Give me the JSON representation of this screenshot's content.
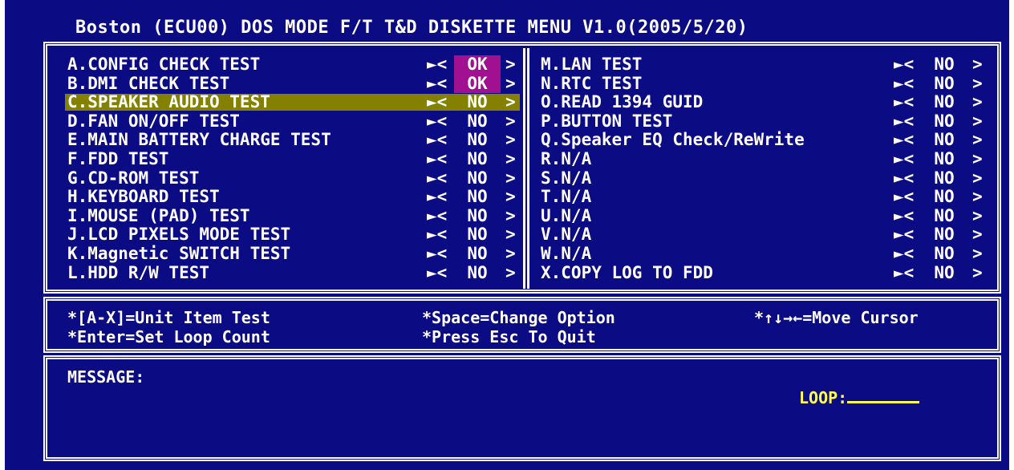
{
  "title": "Boston (ECU00) DOS MODE F/T T&D DISKETTE MENU V1.0(2005/5/20)",
  "arrow_glyph": "►<",
  "close_glyph": ">",
  "left_items": [
    {
      "label": "A.CONFIG CHECK TEST",
      "status": "OK"
    },
    {
      "label": "B.DMI CHECK TEST",
      "status": "OK"
    },
    {
      "label": "C.SPEAKER AUDIO TEST",
      "status": "NO",
      "selected": true
    },
    {
      "label": "D.FAN ON/OFF TEST",
      "status": "NO"
    },
    {
      "label": "E.MAIN BATTERY CHARGE TEST",
      "status": "NO"
    },
    {
      "label": "F.FDD TEST",
      "status": "NO"
    },
    {
      "label": "G.CD-ROM TEST",
      "status": "NO"
    },
    {
      "label": "H.KEYBOARD TEST",
      "status": "NO"
    },
    {
      "label": "I.MOUSE (PAD) TEST",
      "status": "NO"
    },
    {
      "label": "J.LCD PIXELS MODE TEST",
      "status": "NO"
    },
    {
      "label": "K.Magnetic SWITCH TEST",
      "status": "NO"
    },
    {
      "label": "L.HDD R/W TEST",
      "status": "NO"
    }
  ],
  "right_items": [
    {
      "label": "M.LAN TEST",
      "status": "NO"
    },
    {
      "label": "N.RTC TEST",
      "status": "NO"
    },
    {
      "label": "O.READ 1394 GUID",
      "status": "NO"
    },
    {
      "label": "P.BUTTON TEST",
      "status": "NO"
    },
    {
      "label": "Q.Speaker EQ Check/ReWrite",
      "status": "NO"
    },
    {
      "label": "R.N/A",
      "status": "NO"
    },
    {
      "label": "S.N/A",
      "status": "NO"
    },
    {
      "label": "T.N/A",
      "status": "NO"
    },
    {
      "label": "U.N/A",
      "status": "NO"
    },
    {
      "label": "V.N/A",
      "status": "NO"
    },
    {
      "label": "W.N/A",
      "status": "NO"
    },
    {
      "label": "X.COPY LOG TO FDD",
      "status": "NO"
    }
  ],
  "help": {
    "unit_item": "*[A-X]=Unit Item Test",
    "change_option": "*Space=Change Option",
    "move_cursor": "*↑↓→←=Move Cursor",
    "loop_count": "*Enter=Set Loop Count",
    "quit": "*Press Esc To Quit"
  },
  "message_label": "MESSAGE:",
  "loop_label": "LOOP:",
  "colors": {
    "background": "#0b0b84",
    "selected": "#858100",
    "ok_highlight": "#a01090",
    "loop_text": "#ffff55"
  }
}
